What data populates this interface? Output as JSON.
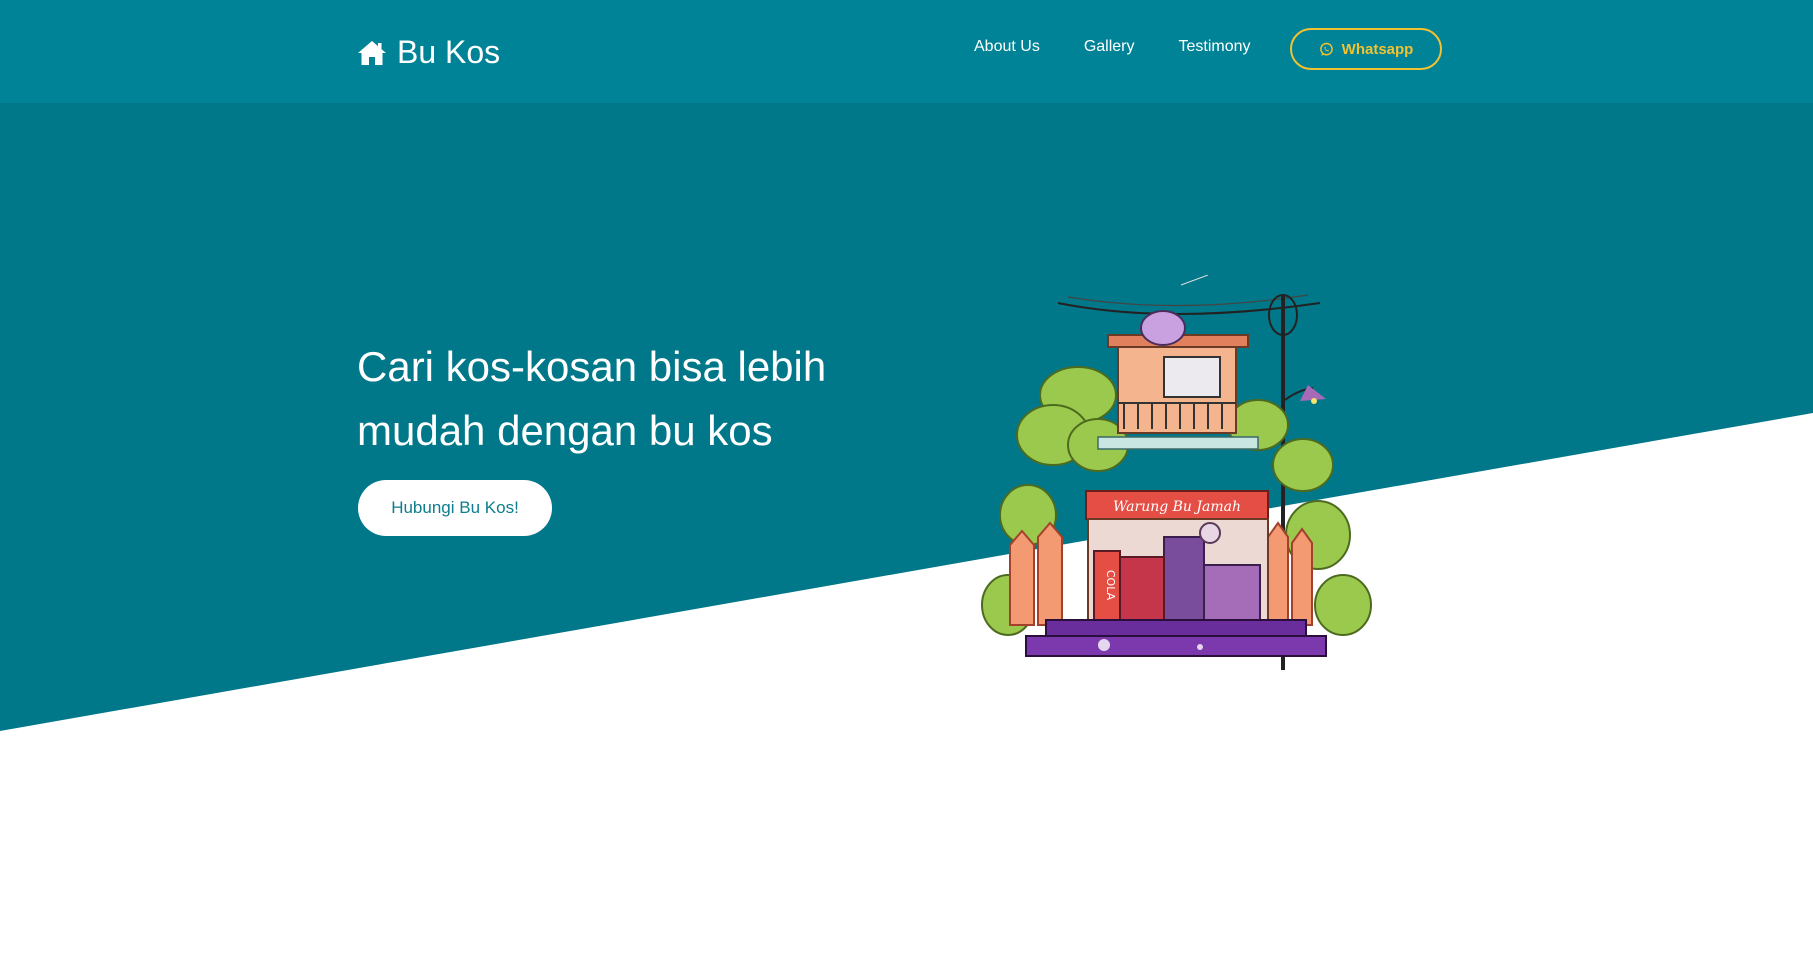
{
  "brand": {
    "name": "Bu Kos",
    "icon": "home-icon"
  },
  "nav": {
    "items": [
      {
        "label": "About Us"
      },
      {
        "label": "Gallery"
      },
      {
        "label": "Testimony"
      }
    ],
    "whatsapp": {
      "label": "Whatsapp",
      "icon": "whatsapp-icon"
    }
  },
  "hero": {
    "title": "Cari kos-kosan bisa lebih mudah dengan bu kos",
    "cta_label": "Hubungi Bu Kos!",
    "illustration": {
      "sign_text": "Warung Bu Jamah",
      "can_text": "COLA"
    }
  },
  "colors": {
    "navbar": "#008396",
    "hero": "#00788A",
    "accent": "#F2C230",
    "cta_text": "#0E7D8C"
  }
}
